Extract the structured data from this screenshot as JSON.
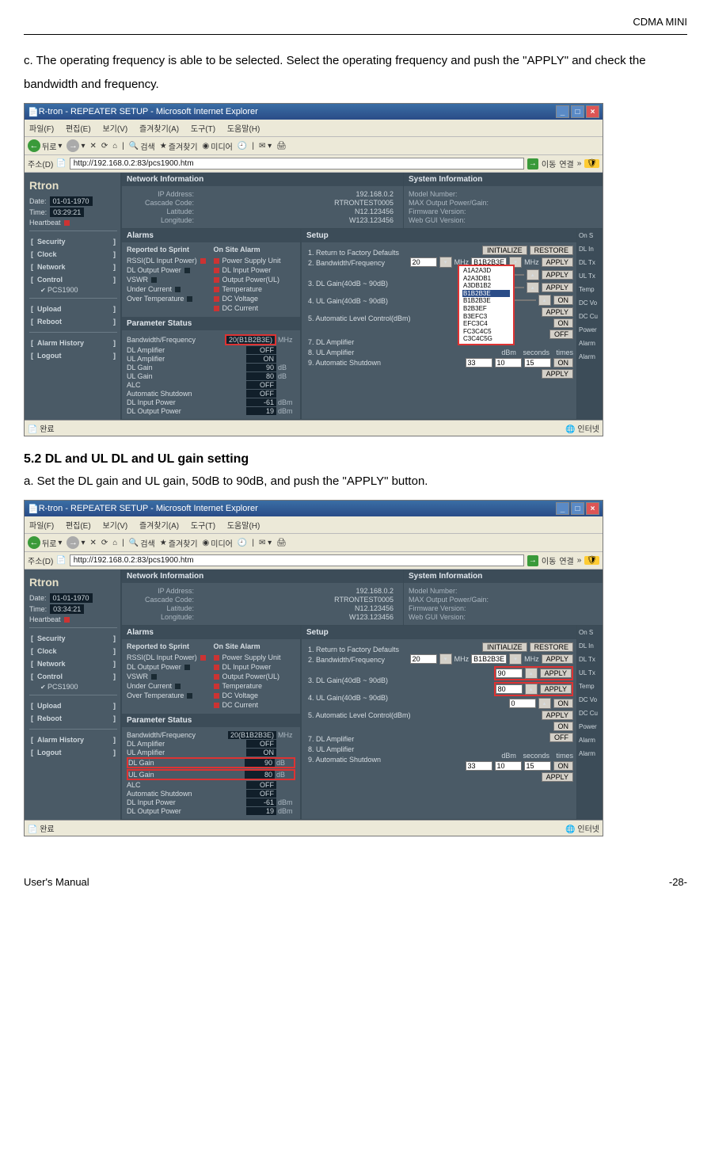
{
  "doc": {
    "header_right": "CDMA MINI",
    "para_c": "c. The operating frequency is able to be selected. Select the operating frequency and push the \"APPLY\" and check the bandwidth and frequency.",
    "section_52": "5.2 DL and UL DL and UL gain setting",
    "para_a": "a. Set the DL gain and UL gain, 50dB to 90dB, and push the \"APPLY\" button.",
    "footer_left": "User's Manual",
    "footer_right": "-28-"
  },
  "ie": {
    "title": "R-tron - REPEATER SETUP - Microsoft Internet Explorer",
    "menu": [
      "파일(F)",
      "편집(E)",
      "보기(V)",
      "즐겨찾기(A)",
      "도구(T)",
      "도움말(H)"
    ],
    "back": "뒤로",
    "search": "검색",
    "fav": "즐겨찾기",
    "media": "미디어",
    "addr_label": "주소(D)",
    "go": "이동",
    "links": "연결",
    "url": "http://192.168.0.2:83/pcs1900.htm",
    "status_left": "완료",
    "status_right": "인터넷"
  },
  "app": {
    "logo": "Rtron",
    "date_label": "Date:",
    "time_label": "Time:",
    "hb_label": "Heartbeat",
    "date_val": "01-01-1970",
    "time1": "03:29:21",
    "time2": "03:34:21",
    "nav": {
      "security": "Security",
      "clock": "Clock",
      "network": "Network",
      "control": "Control",
      "sub": "PCS1900",
      "upload": "Upload",
      "reboot": "Reboot",
      "alarm_history": "Alarm History",
      "logout": "Logout"
    },
    "net": {
      "title": "Network Information",
      "ip_k": "IP Address:",
      "ip_v": "192.168.0.2",
      "cc_k": "Cascade Code:",
      "cc_v": "RTRONTEST0005",
      "lat_k": "Latitude:",
      "lat_v": "N12.123456",
      "lon_k": "Longitude:",
      "lon_v": "W123.123456"
    },
    "sys": {
      "title": "System Information",
      "model": "Model Number:",
      "maxout": "MAX Output Power/Gain:",
      "fw": "Firmware Version:",
      "gui": "Web GUI Version:"
    },
    "alarms": {
      "title": "Alarms",
      "sprint": "Reported to Sprint",
      "onsite": "On Site Alarm",
      "left": [
        "RSSI(DL Input Power)",
        "DL Output Power",
        "VSWR",
        "Under Current",
        "Over Temperature"
      ],
      "right": [
        "Power Supply Unit",
        "DL Input Power",
        "Output Power(UL)",
        "Temperature",
        "DC Voltage",
        "DC Current"
      ]
    },
    "params": {
      "title": "Parameter Status",
      "rows": [
        {
          "k": "Bandwidth/Frequency",
          "v": "20(B1B2B3E)",
          "u": "MHz",
          "hl": true
        },
        {
          "k": "DL Amplifier",
          "v": "OFF",
          "u": ""
        },
        {
          "k": "UL Amplifier",
          "v": "ON",
          "u": ""
        },
        {
          "k": "DL Gain",
          "v": "90",
          "u": "dB"
        },
        {
          "k": "UL Gain",
          "v": "80",
          "u": "dB"
        },
        {
          "k": "ALC",
          "v": "OFF",
          "u": ""
        },
        {
          "k": "Automatic Shutdown",
          "v": "OFF",
          "u": ""
        },
        {
          "k": "DL Input Power",
          "v": "-61",
          "u": "dBm"
        },
        {
          "k": "DL Output Power",
          "v": "19",
          "u": "dBm"
        }
      ]
    },
    "setup": {
      "title": "Setup",
      "lines": [
        "1. Return to Factory Defaults",
        "2. Bandwidth/Frequency",
        "3. DL Gain(40dB ~ 90dB)",
        "4. UL Gain(40dB ~ 90dB)",
        "5. Automatic Level Control(dBm)",
        "7. DL Amplifier",
        "8. UL Amplifier",
        "9. Automatic Shutdown"
      ],
      "bw_val": "20",
      "bw_unit_l": "MHz",
      "freq_val": "B1B2B3E",
      "bw_unit_r": "MHz",
      "dl_gain_val": "90",
      "ul_gain_val": "80",
      "alc_val": "0",
      "init": "INITIALIZE",
      "restore": "RESTORE",
      "apply": "APPLY",
      "on": "ON",
      "off": "OFF",
      "dbm": "dBm",
      "sec": "seconds",
      "times": "times",
      "t1": "33",
      "t2": "10",
      "t3": "15",
      "dropdown": [
        "A1A2A3D",
        "A2A3DB1",
        "A3DB1B2",
        "B1B2B3E",
        "B1B2B3E",
        "B2B3EF",
        "B3EFC3",
        "EFC3C4",
        "FC3C4C5",
        "C3C4C5G"
      ]
    },
    "onset": [
      "On S",
      "DL In",
      "DL Tx",
      "UL Tx",
      "Temp",
      "DC Vo",
      "DC Cu",
      "Power",
      "Alarm",
      "Alarm"
    ]
  }
}
